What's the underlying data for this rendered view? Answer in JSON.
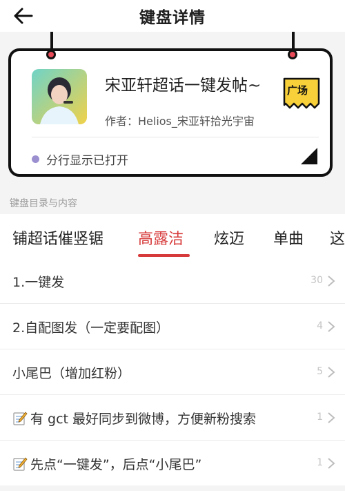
{
  "header": {
    "title": "键盘详情",
    "back_icon": "arrow-left-icon"
  },
  "card": {
    "title": "宋亚轩超话一键发帖~",
    "author": "作者：Helios_宋亚轩拾光宇宙",
    "badge": "广场",
    "status": "分行显示已打开",
    "colors": {
      "pin": "#e94a57",
      "badge": "#f7d03a",
      "status_dot": "#9b8fd0"
    }
  },
  "section_label": "键盘目录与内容",
  "tabs": [
    {
      "label": "铺超话催竖锯"
    },
    {
      "label": "高露洁",
      "active": true
    },
    {
      "label": "炫迈"
    },
    {
      "label": "单曲"
    },
    {
      "label": "这"
    }
  ],
  "accent": "#d73a3a",
  "items": [
    {
      "label": "1.一键发",
      "count": "30"
    },
    {
      "label": "2.自配图发（一定要配图）",
      "count": "4"
    },
    {
      "label": "小尾巴（增加红粉）",
      "count": "5"
    },
    {
      "label": "有 gct 最好同步到微博，方便新粉搜索",
      "count": "1",
      "icon": "memo-icon"
    },
    {
      "label": "先点“一键发”，后点“小尾巴”",
      "count": "1",
      "icon": "memo-icon"
    }
  ]
}
